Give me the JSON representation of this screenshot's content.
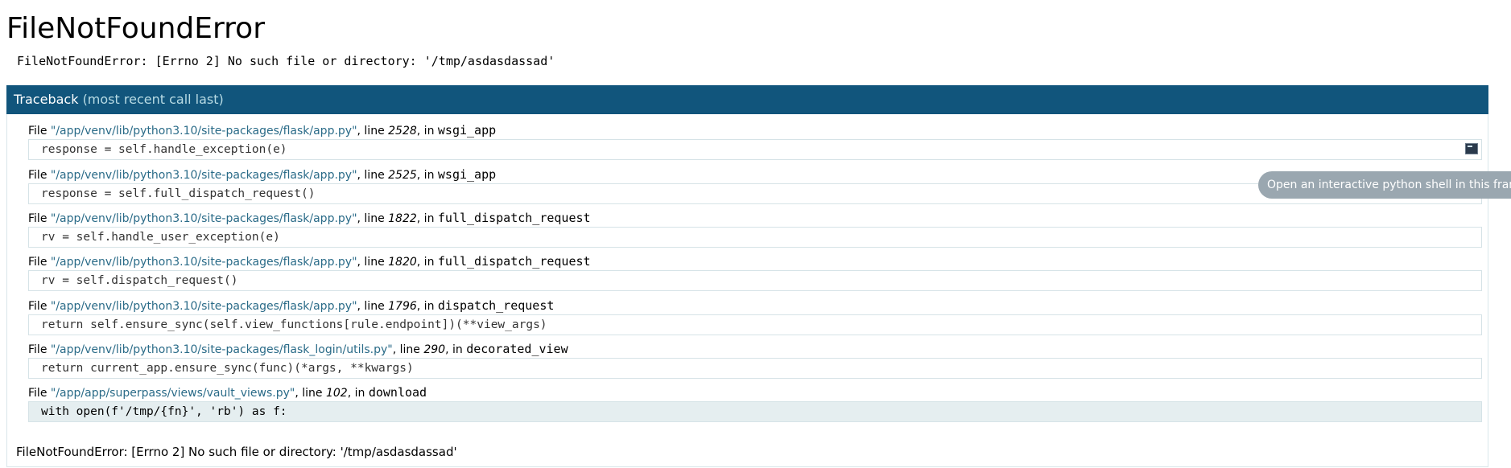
{
  "page_title": "FileNotFoundError",
  "error_message": "FileNotFoundError: [Errno 2] No such file or directory: '/tmp/asdasdassad'",
  "traceback_header": {
    "label": "Traceback",
    "sublabel": "(most recent call last)"
  },
  "frames": [
    {
      "file_prefix": "File ",
      "filename": "\"/app/venv/lib/python3.10/site-packages/flask/app.py\"",
      "line_word": ", line ",
      "lineno": "2528",
      "in_word": ", in ",
      "function": "wsgi_app",
      "code": "response = self.handle_exception(e)"
    },
    {
      "file_prefix": "File ",
      "filename": "\"/app/venv/lib/python3.10/site-packages/flask/app.py\"",
      "line_word": ", line ",
      "lineno": "2525",
      "in_word": ", in ",
      "function": "wsgi_app",
      "code": "response = self.full_dispatch_request()"
    },
    {
      "file_prefix": "File ",
      "filename": "\"/app/venv/lib/python3.10/site-packages/flask/app.py\"",
      "line_word": ", line ",
      "lineno": "1822",
      "in_word": ", in ",
      "function": "full_dispatch_request",
      "code": "rv = self.handle_user_exception(e)"
    },
    {
      "file_prefix": "File ",
      "filename": "\"/app/venv/lib/python3.10/site-packages/flask/app.py\"",
      "line_word": ", line ",
      "lineno": "1820",
      "in_word": ", in ",
      "function": "full_dispatch_request",
      "code": "rv = self.dispatch_request()"
    },
    {
      "file_prefix": "File ",
      "filename": "\"/app/venv/lib/python3.10/site-packages/flask/app.py\"",
      "line_word": ", line ",
      "lineno": "1796",
      "in_word": ", in ",
      "function": "dispatch_request",
      "code": "return self.ensure_sync(self.view_functions[rule.endpoint])(**view_args)"
    },
    {
      "file_prefix": "File ",
      "filename": "\"/app/venv/lib/python3.10/site-packages/flask_login/utils.py\"",
      "line_word": ", line ",
      "lineno": "290",
      "in_word": ", in ",
      "function": "decorated_view",
      "code": "return current_app.ensure_sync(func)(*args, **kwargs)"
    },
    {
      "file_prefix": "File ",
      "filename": "\"/app/app/superpass/views/vault_views.py\"",
      "line_word": ", line ",
      "lineno": "102",
      "in_word": ", in ",
      "function": "download",
      "code": "with open(f'/tmp/{fn}', 'rb') as f:"
    }
  ],
  "console_tooltip": "Open an interactive python shell in this frame",
  "final_exception": "FileNotFoundError: [Errno 2] No such file or directory: '/tmp/asdasdassad'",
  "colors": {
    "header_bg": "#11557c",
    "header_sub": "#b8dbe4",
    "filename_link": "#2a6b88",
    "current_line_bg": "#e5eef0",
    "tooltip_bg": "#9aa7b0"
  },
  "icons": {
    "console": "terminal-icon"
  }
}
